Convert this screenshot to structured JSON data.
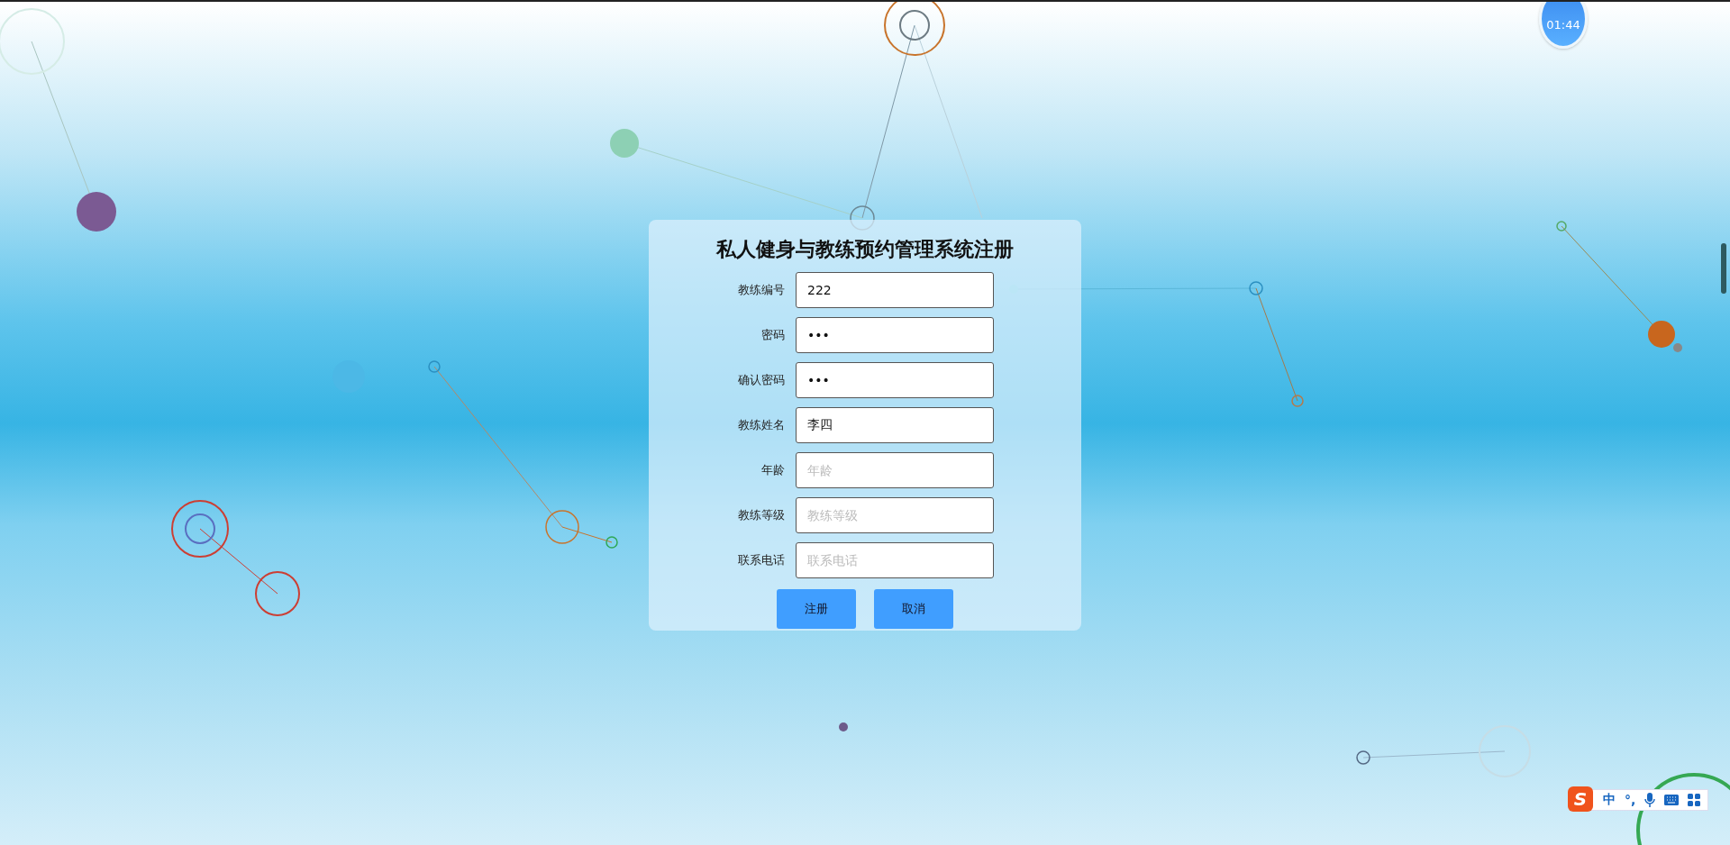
{
  "timer": {
    "text": "01:44"
  },
  "form": {
    "title": "私人健身与教练预约管理系统注册",
    "fields": [
      {
        "label": "教练编号",
        "value": "222"
      },
      {
        "label": "密码",
        "value": "•••"
      },
      {
        "label": "确认密码",
        "value": "•••"
      },
      {
        "label": "教练姓名",
        "value": "李四"
      },
      {
        "label": "年龄",
        "placeholder": "年龄"
      },
      {
        "label": "教练等级",
        "placeholder": "教练等级"
      },
      {
        "label": "联系电话",
        "placeholder": "联系电话"
      }
    ],
    "buttons": [
      "注册",
      "取消"
    ]
  },
  "ime": {
    "logo": "S",
    "mode": "中",
    "punctuation": "°,"
  }
}
